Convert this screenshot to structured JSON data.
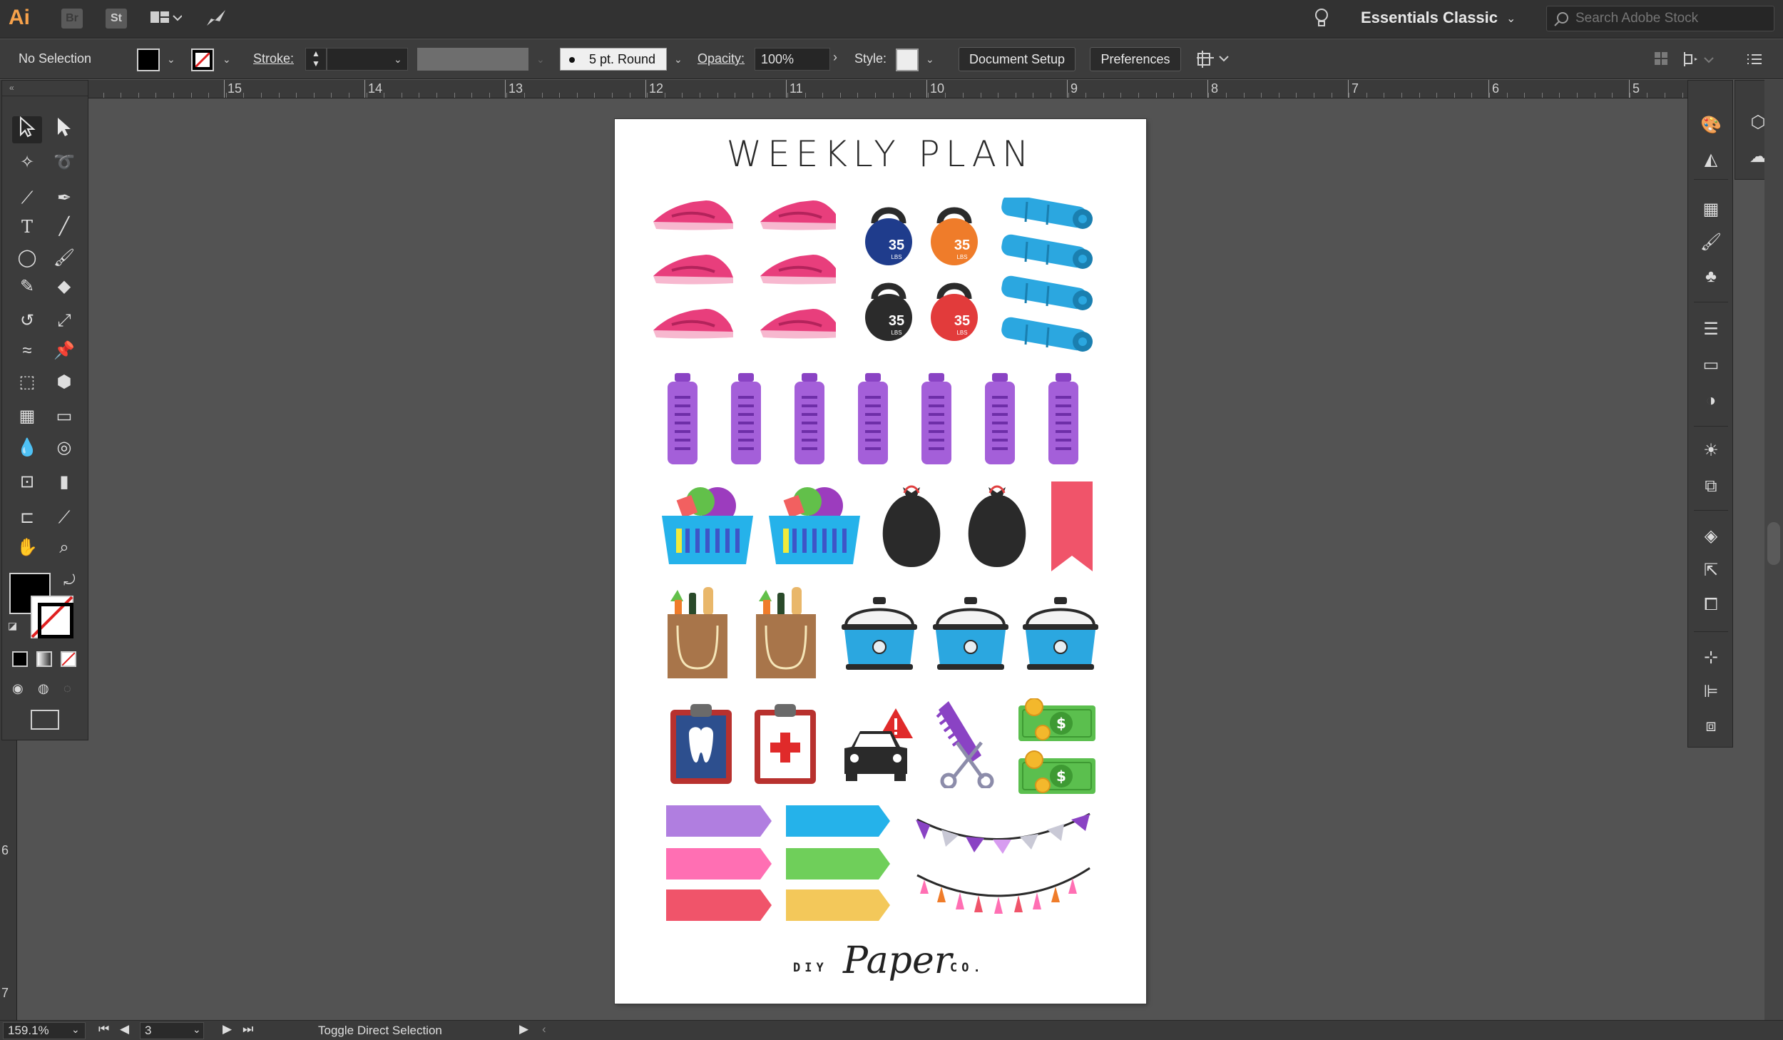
{
  "app": {
    "logo": "Ai",
    "bridge": "Br",
    "stock": "St",
    "workspace": "Essentials Classic",
    "search_placeholder": "Search Adobe Stock"
  },
  "controlbar": {
    "selection": "No Selection",
    "stroke_label": "Stroke:",
    "brush": "5 pt. Round",
    "opacity_label": "Opacity:",
    "opacity_value": "100%",
    "style_label": "Style:",
    "document_setup": "Document Setup",
    "preferences": "Preferences"
  },
  "ruler": {
    "top_labels": [
      "15",
      "14",
      "13",
      "12",
      "11",
      "10",
      "9",
      "8",
      "7",
      "6",
      "5"
    ],
    "left_labels": [
      "6",
      "7"
    ]
  },
  "artboard": {
    "title": "WEEKLY PLAN",
    "brand_left": "DIY",
    "brand_script": "Paper",
    "brand_right": "CO.",
    "kettlebell_label": "35",
    "kettlebell_unit": "LBS"
  },
  "colors": {
    "shoe": "#e83e7c",
    "kettle_navy": "#1f3c8c",
    "kettle_orange": "#ef7c2a",
    "kettle_black": "#2b2b2b",
    "kettle_red": "#e23b3b",
    "mat": "#2ba7e0",
    "bottle": "#a45fd9",
    "basket": "#25b2ea",
    "trash": "#2a2a2a",
    "bookmark": "#f0546a",
    "bag": "#a8754a",
    "pot": "#2ba7e0",
    "money": "#5bbf4e"
  },
  "status": {
    "zoom": "159.1%",
    "artboard_num": "3",
    "tool_hint": "Toggle Direct Selection"
  }
}
